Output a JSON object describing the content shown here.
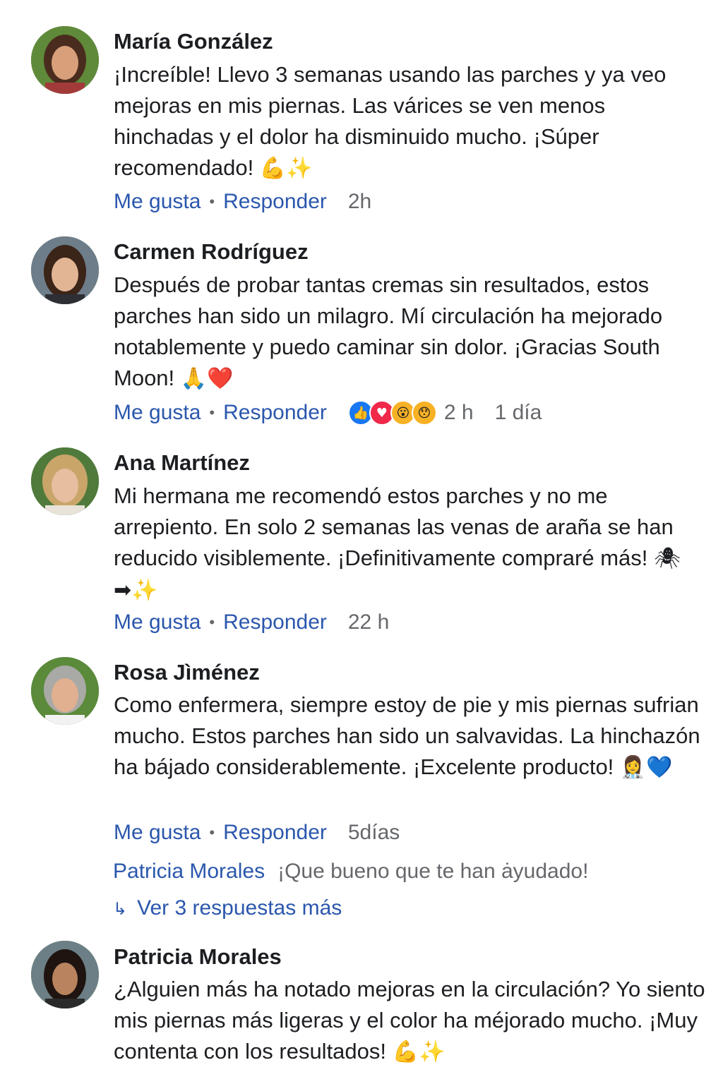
{
  "comments": [
    {
      "name": "María González",
      "text": "¡Increíble! Llevo  3 semanas usando las parches y ya veo mejoras en mis piernas. Las várices se ven menos hinchadas y el dolor ha disminuido mucho. ¡Súper recomendado!",
      "emoji": "💪✨",
      "like": "Me gusta",
      "reply": "Responder",
      "time": "2h"
    },
    {
      "name": "Carmen Rodríguez",
      "text": "Después de probar tantas cremas sin resultados, estos parches han sido un milagro. Mí circulación ha mejorado notablemente y puedo caminar sin dolor. ¡Gracias South Moon!",
      "emoji": "🙏❤️",
      "like": "Me gusta",
      "reply": "Responder",
      "time": "2 h",
      "time2": "1 día"
    },
    {
      "name": "Ana Martínez",
      "text": "Mi hermana me recomendó estos parches y no me arrepiento. En solo 2 semanas las venas de araña se han reducido visiblemente. ¡Definitivamente compraré más!",
      "emoji": "🕷➡✨",
      "like": "Me gusta",
      "reply": "Responder",
      "time": "22 h"
    },
    {
      "name": "Rosa Jìménez",
      "text": "Como enfermera, siempre estoy de pie y mis piernas sufrian mucho. Estos parches han sido un salvavidas. La hinchazón ha bájado considerablemente. ¡Excelente producto!",
      "emoji": "👩‍⚕️💙",
      "like": "Me gusta",
      "reply": "Responder",
      "time": "5días",
      "reply_preview": {
        "name": "Patricia Morales",
        "text": "¡Que bueno que te han ȧyudado!"
      },
      "more_replies": "Ver 3 respuestas más"
    },
    {
      "name": "Patricia Morales",
      "text": "¿Alguien más ha notado mejoras en la circulación? Yo siento mis piernas más ligeras y el color ha méjorado mucho. ¡Muy contenta con los resultados!",
      "emoji": "💪✨"
    }
  ],
  "colors": {
    "link": "#2b57ad",
    "meta": "#65676b",
    "text": "#1c1e21"
  }
}
